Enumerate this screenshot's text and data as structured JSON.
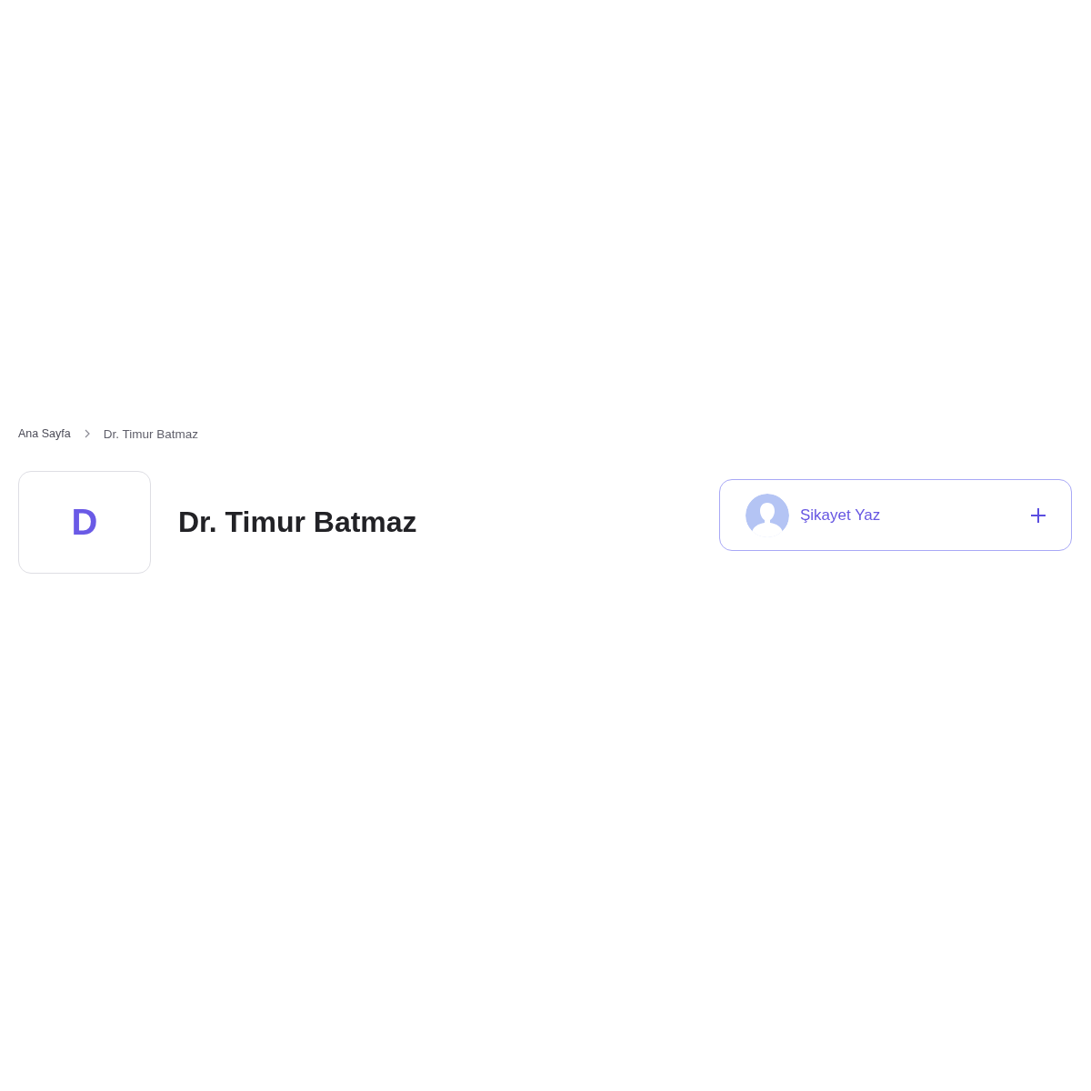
{
  "breadcrumb": [
    {
      "label": "Ana Sayfa",
      "kind": "link"
    },
    {
      "label": "Dr. Timur Batmaz",
      "kind": "current"
    }
  ],
  "profile": {
    "initial": "D",
    "name": "Dr. Timur Batmaz"
  },
  "complaint_button": {
    "label": "Şikayet Yaz"
  }
}
